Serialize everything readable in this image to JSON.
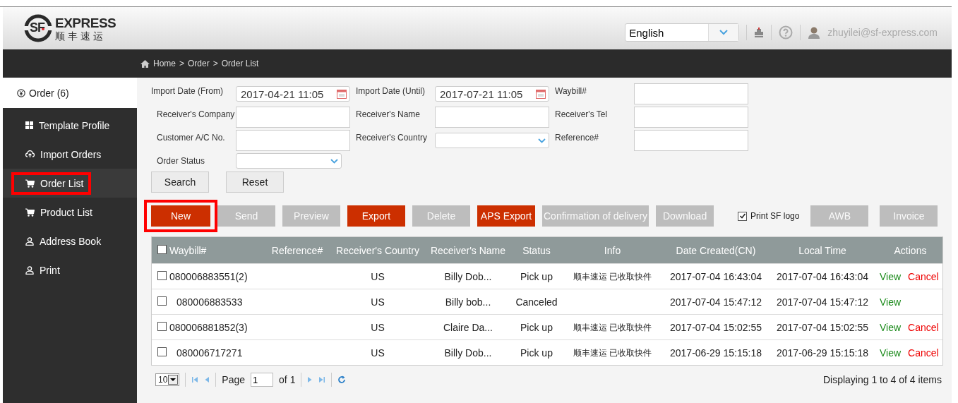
{
  "header": {
    "logo": {
      "mark": "SF",
      "name": "EXPRESS",
      "subtitle": "顺丰速运"
    },
    "language": "English",
    "user": "zhuyilei@sf-express.com"
  },
  "breadcrumb": {
    "separator": ">",
    "items": [
      "Home",
      "Order",
      "Order List"
    ]
  },
  "sidebar": {
    "title": "Order (6)",
    "items": [
      {
        "label": "Template Profile",
        "selected": false,
        "highlighted": false
      },
      {
        "label": "Import Orders",
        "selected": false,
        "highlighted": false
      },
      {
        "label": "Order List",
        "selected": true,
        "highlighted": true
      },
      {
        "label": "Product List",
        "selected": false,
        "highlighted": false
      },
      {
        "label": "Address Book",
        "selected": false,
        "highlighted": false
      },
      {
        "label": "Print",
        "selected": false,
        "highlighted": false
      }
    ]
  },
  "filters": [
    {
      "label": "Import Date (From)",
      "kind": "date",
      "value": "2017-04-21 11:05"
    },
    {
      "label": "Import Date (Until)",
      "kind": "date",
      "value": "2017-07-21 11:05"
    },
    {
      "label": "Waybill#",
      "kind": "text"
    },
    {
      "label": "Receiver's Company",
      "kind": "text"
    },
    {
      "label": "Receiver's Name",
      "kind": "text"
    },
    {
      "label": "Receiver's Tel",
      "kind": "text"
    },
    {
      "label": "Customer A/C No.",
      "kind": "text"
    },
    {
      "label": "Receiver's Country",
      "kind": "select"
    },
    {
      "label": "Reference#",
      "kind": "text"
    },
    {
      "label": "Order Status",
      "kind": "select"
    }
  ],
  "filter_buttons": [
    "Search",
    "Reset"
  ],
  "actions": [
    {
      "label": "New",
      "disabled": false,
      "highlighted": true
    },
    {
      "label": "Send",
      "disabled": true,
      "highlighted": false
    },
    {
      "label": "Preview",
      "disabled": true,
      "highlighted": false
    },
    {
      "label": "Export",
      "disabled": false,
      "highlighted": false
    },
    {
      "label": "Delete",
      "disabled": true,
      "highlighted": false
    },
    {
      "label": "APS Export",
      "disabled": false,
      "highlighted": false
    },
    {
      "label": "Confirmation of delivery",
      "disabled": true,
      "highlighted": false
    },
    {
      "label": "Download",
      "disabled": true,
      "highlighted": false
    }
  ],
  "print_logo": {
    "label": "Print SF logo",
    "checked": true
  },
  "print_buttons": [
    {
      "label": "AWB",
      "disabled": true
    },
    {
      "label": "Invoice",
      "disabled": true
    }
  ],
  "table": {
    "select_all": false,
    "columns": [
      "Waybill#",
      "Reference#",
      "Receiver's Country",
      "Receiver's Name",
      "Status",
      "Info",
      "Date Created(CN)",
      "Local Time",
      "Actions"
    ],
    "rows": [
      {
        "checked": false,
        "cells": [
          "080006883551(2)",
          "",
          "US",
          "Billy Dob...",
          "Pick up",
          "顺丰速运 已收取快件",
          "2017-07-04 16:43:04",
          "2017-07-04 16:43:04"
        ],
        "actions": [
          {
            "label": "View",
            "kind": "view"
          },
          {
            "label": "Cancel",
            "kind": "cancel"
          }
        ]
      },
      {
        "checked": false,
        "cells": [
          "080006883533",
          "",
          "US",
          "Billy bob...",
          "Canceled",
          "",
          "2017-07-04 15:47:12",
          "2017-07-04 15:47:12"
        ],
        "actions": [
          {
            "label": "View",
            "kind": "view"
          }
        ]
      },
      {
        "checked": false,
        "cells": [
          "080006881852(3)",
          "",
          "US",
          "Claire Da...",
          "Pick up",
          "顺丰速运 已收取快件",
          "2017-07-04 15:02:55",
          "2017-07-04 15:02:55"
        ],
        "actions": [
          {
            "label": "View",
            "kind": "view"
          },
          {
            "label": "Cancel",
            "kind": "cancel"
          }
        ]
      },
      {
        "checked": false,
        "cells": [
          "080006717271",
          "",
          "US",
          "Billy Dob...",
          "Pick up",
          "顺丰速运 已收取快件",
          "2017-06-29 15:15:18",
          "2017-06-29 15:15:18"
        ],
        "actions": [
          {
            "label": "View",
            "kind": "view"
          },
          {
            "label": "Cancel",
            "kind": "cancel"
          }
        ]
      }
    ]
  },
  "pager": {
    "page_size": "10",
    "page_label": "Page",
    "page": "1",
    "of": "of 1",
    "summary": "Displaying 1 to 4 of 4 items"
  }
}
